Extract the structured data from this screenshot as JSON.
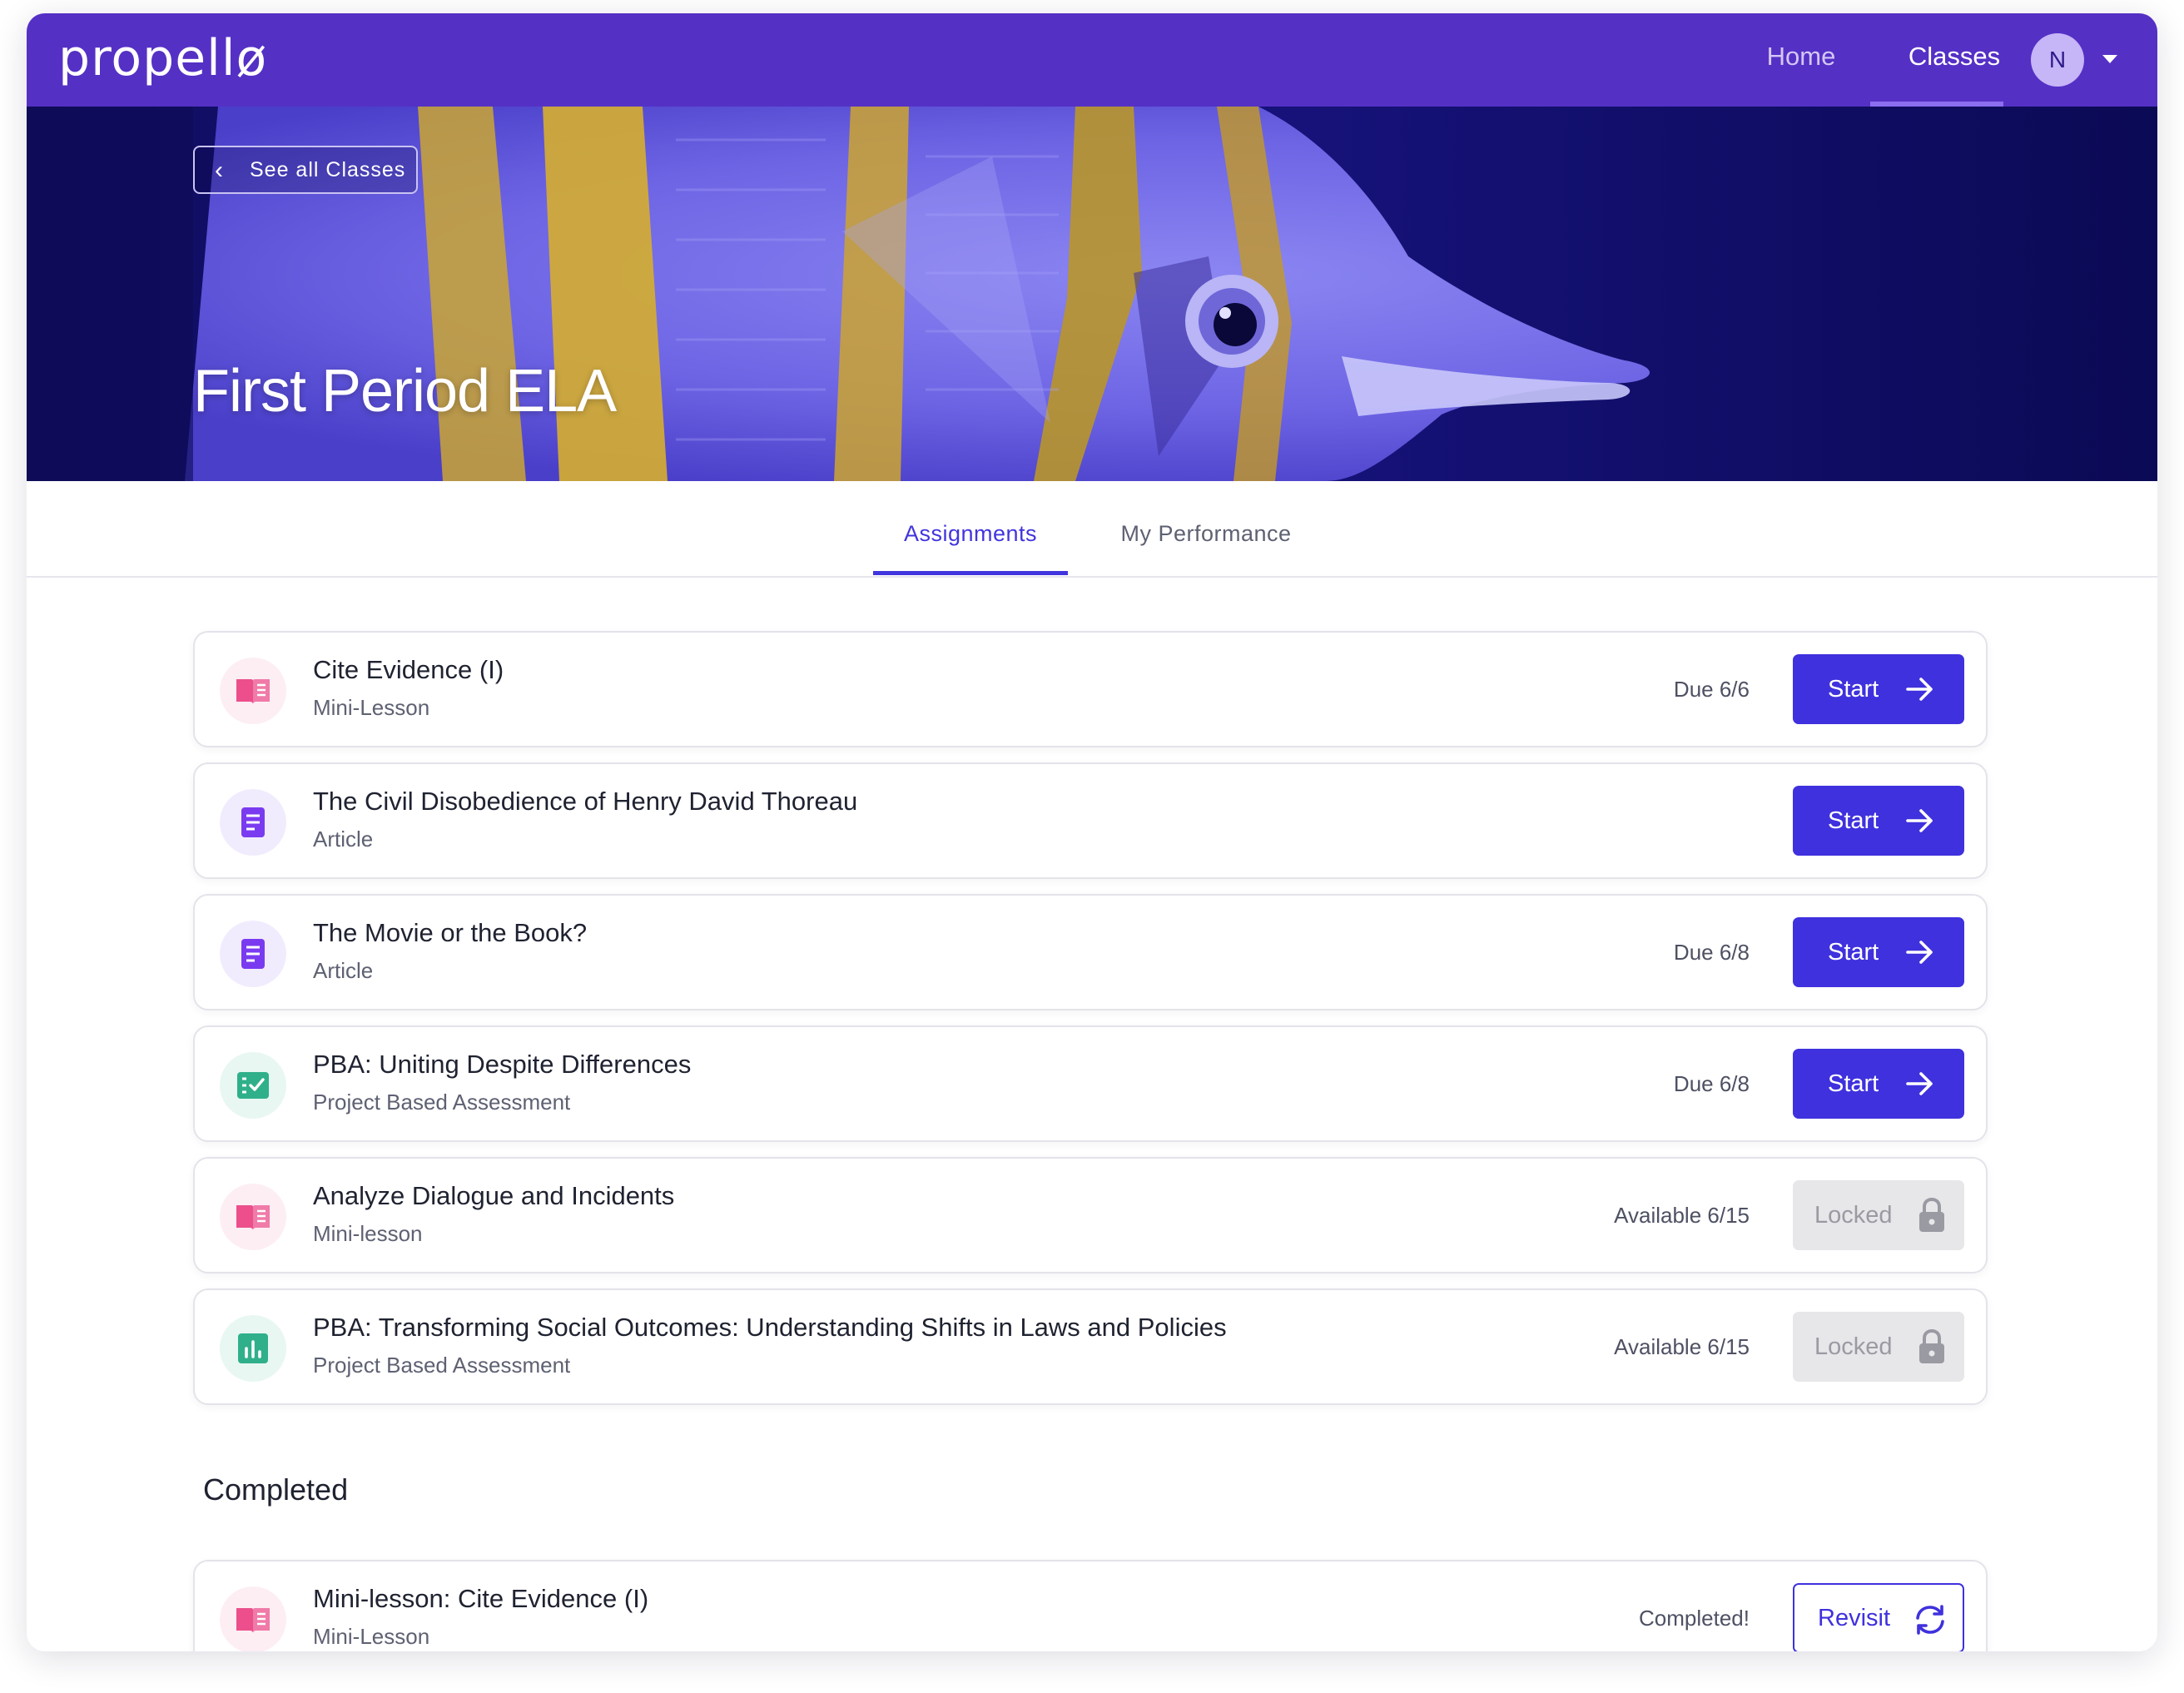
{
  "nav": {
    "logo": "propellø",
    "links": {
      "home": "Home",
      "classes": "Classes"
    },
    "avatar_initial": "N",
    "active": "Classes"
  },
  "hero": {
    "back_label": "See all Classes",
    "title": "First Period ELA"
  },
  "tabs": {
    "assignments": "Assignments",
    "performance": "My Performance",
    "active": "Assignments"
  },
  "assignments": [
    {
      "title": "Cite Evidence (I)",
      "type": "Mini-Lesson",
      "status": "Due 6/6",
      "action": "Start",
      "icon": "book-icon"
    },
    {
      "title": "The Civil Disobedience of Henry David Thoreau",
      "type": "Article",
      "status": "",
      "action": "Start",
      "icon": "article-icon"
    },
    {
      "title": "The Movie or the Book?",
      "type": "Article",
      "status": "Due 6/8",
      "action": "Start",
      "icon": "article-icon"
    },
    {
      "title": "PBA: Uniting Despite Differences",
      "type": "Project Based Assessment",
      "status": "Due 6/8",
      "action": "Start",
      "icon": "checklist-icon"
    },
    {
      "title": "Analyze Dialogue and Incidents",
      "type": "Mini-lesson",
      "status": "Available 6/15",
      "action": "Locked",
      "icon": "book-icon"
    },
    {
      "title": "PBA: Transforming Social Outcomes: Understanding Shifts in Laws and Policies",
      "type": "Project Based Assessment",
      "status": "Available 6/15",
      "action": "Locked",
      "icon": "bar-chart-icon"
    }
  ],
  "completed": {
    "heading": "Completed",
    "items": [
      {
        "title": "Mini-lesson: Cite Evidence (I)",
        "type": "Mini-Lesson",
        "status": "Completed!",
        "action": "Revisit",
        "icon": "book-icon"
      }
    ]
  },
  "colors": {
    "brand": "#5530c5",
    "accent": "#3f31dd",
    "book_icon": "#ec4f8c",
    "article_icon": "#7a3bf0",
    "pba_icon": "#2fb08a",
    "locked_bg": "#e7e7ea"
  }
}
